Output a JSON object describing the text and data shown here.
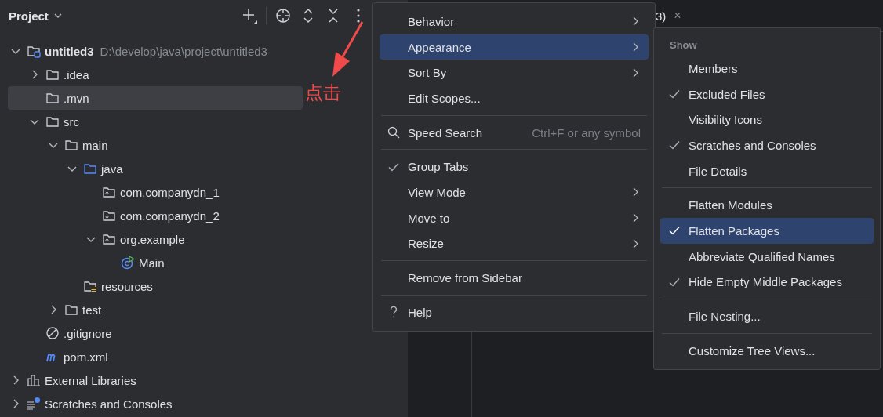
{
  "project_panel": {
    "title": "Project",
    "tree": [
      {
        "label": "untitled3",
        "path": "D:\\develop\\java\\project\\untitled3",
        "kind": "module",
        "expanded": true,
        "selected": false,
        "children": [
          {
            "label": ".idea",
            "kind": "folder",
            "expanded": false,
            "selected": false
          },
          {
            "label": ".mvn",
            "kind": "folder",
            "selected": true
          },
          {
            "label": "src",
            "kind": "folder",
            "expanded": true,
            "selected": false,
            "children": [
              {
                "label": "main",
                "kind": "folder",
                "expanded": true,
                "selected": false,
                "children": [
                  {
                    "label": "java",
                    "kind": "source",
                    "expanded": true,
                    "selected": false,
                    "children": [
                      {
                        "label": "com.companydn_1",
                        "kind": "package",
                        "selected": false
                      },
                      {
                        "label": "com.companydn_2",
                        "kind": "package",
                        "selected": false
                      },
                      {
                        "label": "org.example",
                        "kind": "package",
                        "expanded": true,
                        "selected": false,
                        "children": [
                          {
                            "label": "Main",
                            "kind": "class",
                            "selected": false
                          }
                        ]
                      }
                    ]
                  },
                  {
                    "label": "resources",
                    "kind": "resources",
                    "selected": false
                  }
                ]
              },
              {
                "label": "test",
                "kind": "folder",
                "expanded": false,
                "selected": false
              }
            ]
          },
          {
            "label": ".gitignore",
            "kind": "ignore",
            "selected": false
          },
          {
            "label": "pom.xml",
            "kind": "maven",
            "selected": false
          }
        ]
      },
      {
        "label": "External Libraries",
        "kind": "libraries",
        "expanded": false,
        "selected": false
      },
      {
        "label": "Scratches and Consoles",
        "kind": "scratches",
        "expanded": false,
        "selected": false
      }
    ]
  },
  "annotation": {
    "text": "点击"
  },
  "editor_tab": {
    "label": "3)",
    "close": "×"
  },
  "options_menu": [
    {
      "kind": "item",
      "label": "Behavior",
      "submenu": true,
      "selected": false
    },
    {
      "kind": "item",
      "label": "Appearance",
      "submenu": true,
      "selected": true
    },
    {
      "kind": "item",
      "label": "Sort By",
      "submenu": true,
      "selected": false
    },
    {
      "kind": "item",
      "label": "Edit Scopes...",
      "submenu": false,
      "selected": false
    },
    {
      "kind": "separator"
    },
    {
      "kind": "search",
      "label": "Speed Search",
      "shortcut": "Ctrl+F or any symbol",
      "selected": false
    },
    {
      "kind": "separator"
    },
    {
      "kind": "item",
      "label": "Group Tabs",
      "checked": true,
      "submenu": false,
      "selected": false
    },
    {
      "kind": "item",
      "label": "View Mode",
      "checked": false,
      "submenu": true,
      "selected": false
    },
    {
      "kind": "item",
      "label": "Move to",
      "checked": false,
      "submenu": true,
      "selected": false
    },
    {
      "kind": "item",
      "label": "Resize",
      "checked": false,
      "submenu": true,
      "selected": false
    },
    {
      "kind": "separator"
    },
    {
      "kind": "item",
      "label": "Remove from Sidebar",
      "submenu": false,
      "selected": false
    },
    {
      "kind": "separator"
    },
    {
      "kind": "help",
      "label": "Help",
      "selected": false
    }
  ],
  "appearance_menu": [
    {
      "kind": "header",
      "label": "Show"
    },
    {
      "kind": "item",
      "label": "Members",
      "checked": false,
      "selected": false
    },
    {
      "kind": "item",
      "label": "Excluded Files",
      "checked": true,
      "selected": false
    },
    {
      "kind": "item",
      "label": "Visibility Icons",
      "checked": false,
      "selected": false
    },
    {
      "kind": "item",
      "label": "Scratches and Consoles",
      "checked": true,
      "selected": false
    },
    {
      "kind": "item",
      "label": "File Details",
      "checked": false,
      "selected": false
    },
    {
      "kind": "separator"
    },
    {
      "kind": "item",
      "label": "Flatten Modules",
      "checked": false,
      "selected": false
    },
    {
      "kind": "item",
      "label": "Flatten Packages",
      "checked": true,
      "selected": true
    },
    {
      "kind": "item",
      "label": "Abbreviate Qualified Names",
      "checked": false,
      "selected": false
    },
    {
      "kind": "item",
      "label": "Hide Empty Middle Packages",
      "checked": true,
      "selected": false
    },
    {
      "kind": "separator"
    },
    {
      "kind": "item",
      "label": "File Nesting...",
      "checked": false,
      "selected": false
    },
    {
      "kind": "separator"
    },
    {
      "kind": "item",
      "label": "Customize Tree Views...",
      "checked": false,
      "selected": false
    }
  ]
}
